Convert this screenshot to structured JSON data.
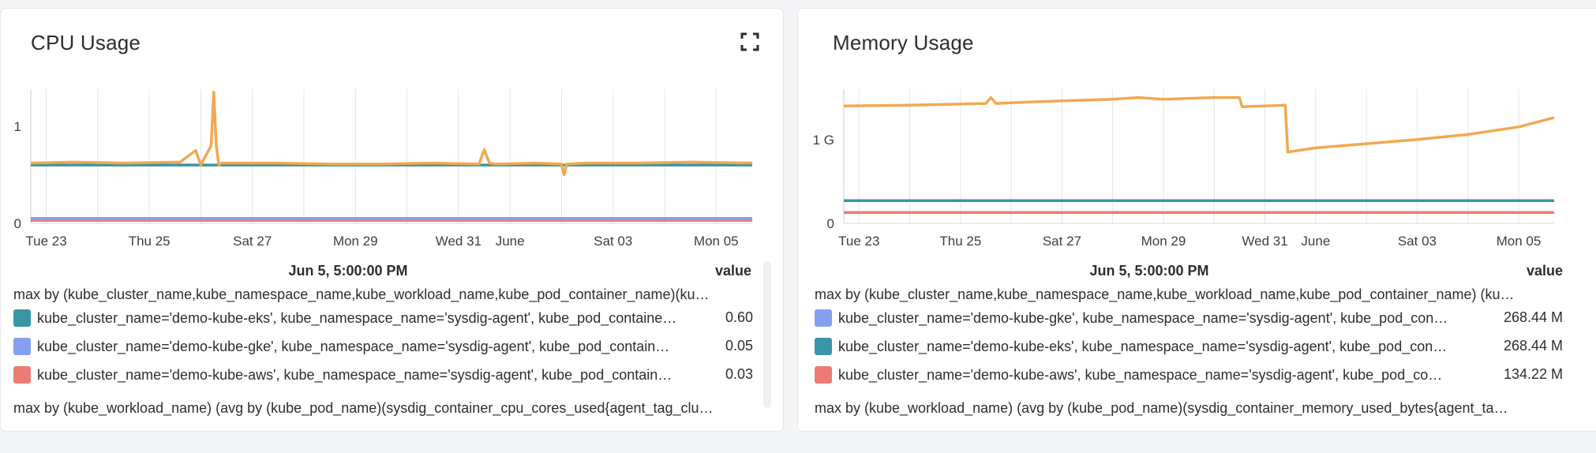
{
  "panels": {
    "cpu": {
      "title": "CPU Usage",
      "tooltip_time": "Jun 5, 5:00:00 PM",
      "value_header": "value",
      "query_head": "max by (kube_cluster_name,kube_namespace_name,kube_workload_name,kube_pod_container_name)(ku…",
      "query_tail": "max by (kube_workload_name) (avg by (kube_pod_name)(sysdig_container_cpu_cores_used{agent_tag_clu…",
      "legend": [
        {
          "label": "kube_cluster_name='demo-kube-eks', kube_namespace_name='sysdig-agent', kube_pod_containe…",
          "value": "0.60",
          "color": "#3a95a6"
        },
        {
          "label": "kube_cluster_name='demo-kube-gke', kube_namespace_name='sysdig-agent', kube_pod_contain…",
          "value": "0.05",
          "color": "#86a0f0"
        },
        {
          "label": "kube_cluster_name='demo-kube-aws', kube_namespace_name='sysdig-agent', kube_pod_contain…",
          "value": "0.03",
          "color": "#ec7b76"
        }
      ]
    },
    "mem": {
      "title": "Memory Usage",
      "tooltip_time": "Jun 5, 5:00:00 PM",
      "value_header": "value",
      "query_head": "max by (kube_cluster_name,kube_namespace_name,kube_workload_name,kube_pod_container_name) (ku…",
      "query_tail": "max by (kube_workload_name) (avg by (kube_pod_name)(sysdig_container_memory_used_bytes{agent_ta…",
      "legend": [
        {
          "label": "kube_cluster_name='demo-kube-gke', kube_namespace_name='sysdig-agent', kube_pod_con…",
          "value": "268.44 M",
          "color": "#86a0f0"
        },
        {
          "label": "kube_cluster_name='demo-kube-eks', kube_namespace_name='sysdig-agent', kube_pod_con…",
          "value": "268.44 M",
          "color": "#3a95a6"
        },
        {
          "label": "kube_cluster_name='demo-kube-aws', kube_namespace_name='sysdig-agent', kube_pod_co…",
          "value": "134.22 M",
          "color": "#ec7b76"
        }
      ]
    }
  },
  "chart_data": [
    {
      "type": "line",
      "title": "CPU Usage",
      "x_tick_labels": [
        "Tue 23",
        "Thu 25",
        "Sat 27",
        "Mon 29",
        "Wed 31",
        "June",
        "Sat 03",
        "Mon 05"
      ],
      "x_ticks_day": [
        0,
        2,
        4,
        6,
        8,
        9,
        11,
        13
      ],
      "x_range_day": [
        -0.3,
        13.7
      ],
      "y_tick_labels": [
        "0",
        "1"
      ],
      "y_ticks": [
        0,
        1
      ],
      "ylim": [
        0,
        1.38
      ],
      "grid": "vertical",
      "series": [
        {
          "label": "demo-kube-eks (orange)",
          "color": "#f2a851",
          "x_day": [
            -0.3,
            0.5,
            1.5,
            2.6,
            2.9,
            3.0,
            3.2,
            3.25,
            3.3,
            3.35,
            3.4,
            4.5,
            5.5,
            6.5,
            7.5,
            8.4,
            8.5,
            8.6,
            8.7,
            9.5,
            10.0,
            10.05,
            10.1,
            10.5,
            11.5,
            12.5,
            13.7
          ],
          "y": [
            0.62,
            0.63,
            0.62,
            0.63,
            0.75,
            0.6,
            0.8,
            1.35,
            0.8,
            0.6,
            0.62,
            0.62,
            0.61,
            0.61,
            0.62,
            0.61,
            0.76,
            0.62,
            0.61,
            0.62,
            0.61,
            0.5,
            0.61,
            0.62,
            0.62,
            0.63,
            0.62
          ]
        },
        {
          "label": "demo-kube-eks (teal)",
          "color": "#3a95a6",
          "x_day": [
            -0.3,
            13.7
          ],
          "y": [
            0.6,
            0.6
          ]
        },
        {
          "label": "demo-kube-gke",
          "color": "#86a0f0",
          "x_day": [
            -0.3,
            13.7
          ],
          "y": [
            0.05,
            0.05
          ]
        },
        {
          "label": "demo-kube-aws",
          "color": "#ec7b76",
          "x_day": [
            -0.3,
            13.7
          ],
          "y": [
            0.03,
            0.03
          ]
        }
      ]
    },
    {
      "type": "line",
      "title": "Memory Usage",
      "x_tick_labels": [
        "Tue 23",
        "Thu 25",
        "Sat 27",
        "Mon 29",
        "Wed 31",
        "June",
        "Sat 03",
        "Mon 05"
      ],
      "x_ticks_day": [
        0,
        2,
        4,
        6,
        8,
        9,
        11,
        13
      ],
      "x_range_day": [
        -0.3,
        13.7
      ],
      "y_tick_labels": [
        "0",
        "1 G"
      ],
      "y_ticks": [
        0,
        1.0
      ],
      "ylim": [
        0,
        1.6
      ],
      "grid": "vertical",
      "series": [
        {
          "label": "memory (orange)",
          "color": "#f2a851",
          "x_day": [
            -0.3,
            1.0,
            2.5,
            2.6,
            2.7,
            3.5,
            5.0,
            5.5,
            6.0,
            7.0,
            7.5,
            7.55,
            8.0,
            8.4,
            8.45,
            9.0,
            10.0,
            11.0,
            12.0,
            13.0,
            13.7
          ],
          "y": [
            1.4,
            1.41,
            1.43,
            1.5,
            1.43,
            1.45,
            1.48,
            1.5,
            1.48,
            1.5,
            1.5,
            1.39,
            1.4,
            1.41,
            0.85,
            0.9,
            0.95,
            1.0,
            1.06,
            1.15,
            1.26
          ]
        },
        {
          "label": "demo-kube-eks",
          "color": "#3a95a6",
          "x_day": [
            -0.3,
            13.7
          ],
          "y": [
            0.27,
            0.27
          ]
        },
        {
          "label": "demo-kube-aws",
          "color": "#ec7b76",
          "x_day": [
            -0.3,
            13.7
          ],
          "y": [
            0.13,
            0.13
          ]
        }
      ]
    }
  ]
}
